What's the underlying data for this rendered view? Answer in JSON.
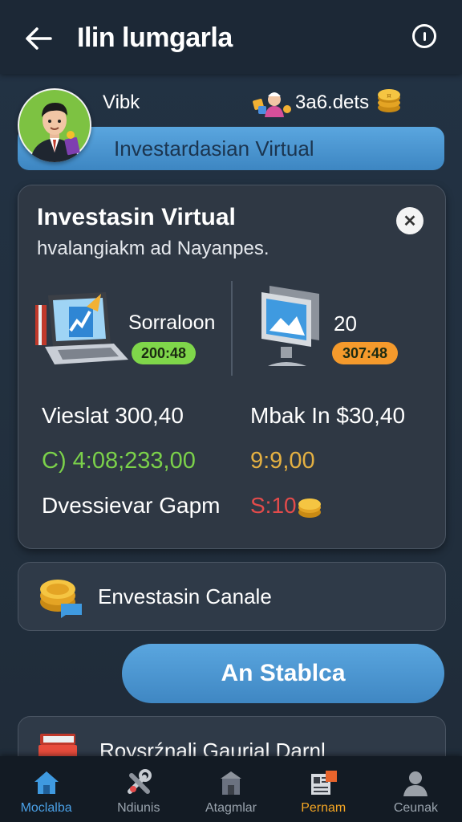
{
  "header": {
    "title": "Ilin lumgarla",
    "back_icon": "arrow-left-icon",
    "info_icon": "info-icon"
  },
  "profile": {
    "username": "Vibk",
    "balance": "3a6.dets",
    "banner_label": "Investardasian Virtual"
  },
  "investment_card": {
    "title": "Investasin Virtual",
    "subtitle": "hvalangiakm ad Nayanpes.",
    "asset_left": {
      "name": "Sorraloon",
      "badge": "200:48",
      "icon": "laptop-chart-icon"
    },
    "asset_right": {
      "quantity": "20",
      "badge": "307:48",
      "icon": "monitor-icon"
    },
    "stat_left": "Vieslat 300,40",
    "stat_right": "Mbak In $30,40",
    "value_green": "C) 4:08;233,00",
    "value_yellow": "9:9,00",
    "gain_label": "Dvessievar Gapm",
    "value_red": "S:10"
  },
  "secondary_card": {
    "label": "Envestasin Canale"
  },
  "cta": {
    "label": "An Stablca"
  },
  "third_card": {
    "label": "Roysrźnali Gaurial Darnl"
  },
  "nav": [
    {
      "label": "Moclalba",
      "icon": "home-icon"
    },
    {
      "label": "Ndiunis",
      "icon": "tools-icon"
    },
    {
      "label": "Atagmlar",
      "icon": "store-icon"
    },
    {
      "label": "Pernam",
      "icon": "newspaper-icon"
    },
    {
      "label": "Ceunak",
      "icon": "user-icon"
    }
  ],
  "colors": {
    "accent_blue": "#4a9bd8",
    "green": "#7bd14a",
    "orange": "#f59a2c",
    "red": "#e34b4b",
    "active_nav": "#f5a623"
  }
}
